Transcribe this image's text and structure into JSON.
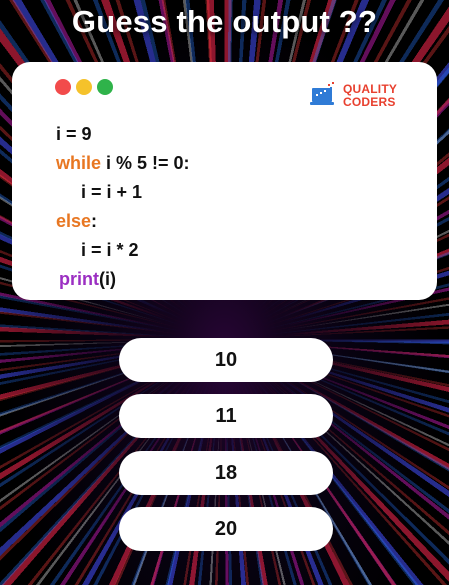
{
  "title": "Guess the output ??",
  "window_controls": [
    "red-dot",
    "yellow-dot",
    "green-dot"
  ],
  "logo": {
    "line1": "QUALITY",
    "line2": "CODERS",
    "icon": "laptop-chart-icon"
  },
  "code": {
    "l1": "i = 9",
    "l2_kw": "while",
    "l2_rest": " i % 5 != 0:",
    "l3": "i = i + 1",
    "l4_kw": "else",
    "l4_rest": ":",
    "l5": "i = i * 2",
    "l6_kw": "print",
    "l6_rest": "(i)"
  },
  "options": [
    "10",
    "11",
    "18",
    "20"
  ],
  "colors": {
    "keyword_control": "#e87722",
    "keyword_builtin": "#9b2fc2",
    "brand": "#e8402f"
  }
}
